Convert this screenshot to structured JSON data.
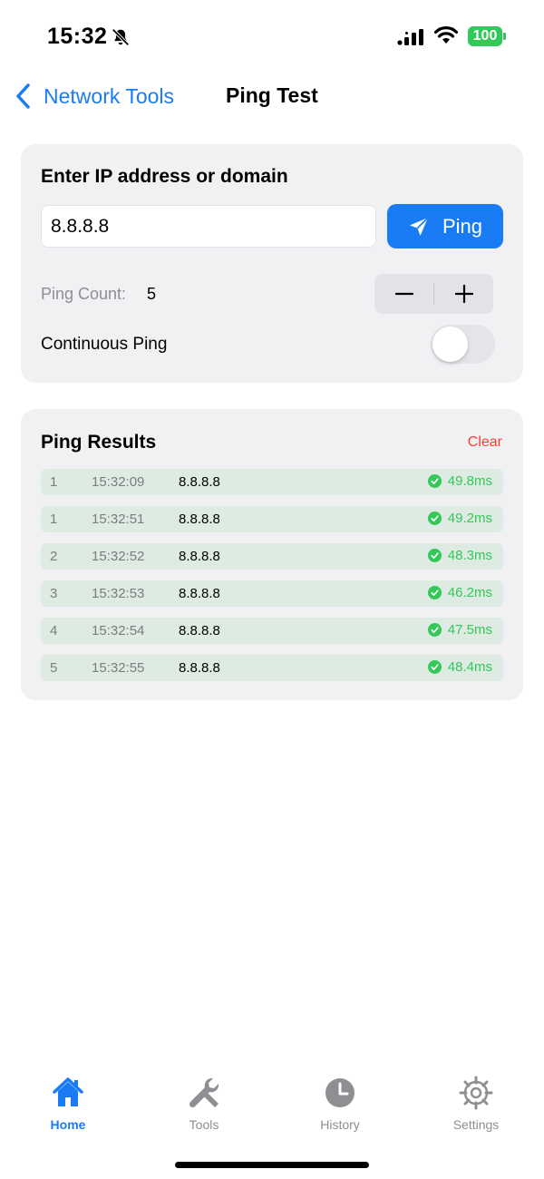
{
  "status_bar": {
    "time": "15:32",
    "battery": "100",
    "icons": [
      "bell-slash-icon",
      "signal-icon",
      "wifi-icon",
      "battery-icon"
    ]
  },
  "nav": {
    "back_label": "Network Tools",
    "title": "Ping Test"
  },
  "input_card": {
    "heading": "Enter IP address or domain",
    "ip_value": "8.8.8.8",
    "ping_button_label": "Ping",
    "ping_count_label": "Ping Count:",
    "ping_count_value": "5",
    "continuous_label": "Continuous Ping",
    "continuous_on": false
  },
  "results": {
    "title": "Ping Results",
    "clear_label": "Clear",
    "rows": [
      {
        "index": "1",
        "time": "15:32:09",
        "host": "8.8.8.8",
        "latency": "49.8ms"
      },
      {
        "index": "1",
        "time": "15:32:51",
        "host": "8.8.8.8",
        "latency": "49.2ms"
      },
      {
        "index": "2",
        "time": "15:32:52",
        "host": "8.8.8.8",
        "latency": "48.3ms"
      },
      {
        "index": "3",
        "time": "15:32:53",
        "host": "8.8.8.8",
        "latency": "46.2ms"
      },
      {
        "index": "4",
        "time": "15:32:54",
        "host": "8.8.8.8",
        "latency": "47.5ms"
      },
      {
        "index": "5",
        "time": "15:32:55",
        "host": "8.8.8.8",
        "latency": "48.4ms"
      }
    ]
  },
  "tab_bar": {
    "tabs": [
      {
        "label": "Home",
        "icon": "home-icon",
        "active": true
      },
      {
        "label": "Tools",
        "icon": "wrench-icon",
        "active": false
      },
      {
        "label": "History",
        "icon": "clock-icon",
        "active": false
      },
      {
        "label": "Settings",
        "icon": "gear-icon",
        "active": false
      }
    ]
  },
  "colors": {
    "accent": "#1a7cf5",
    "success": "#34c759",
    "destructive": "#ff3b30",
    "card_bg": "#f1f1f4",
    "row_bg": "#ddebe2"
  }
}
